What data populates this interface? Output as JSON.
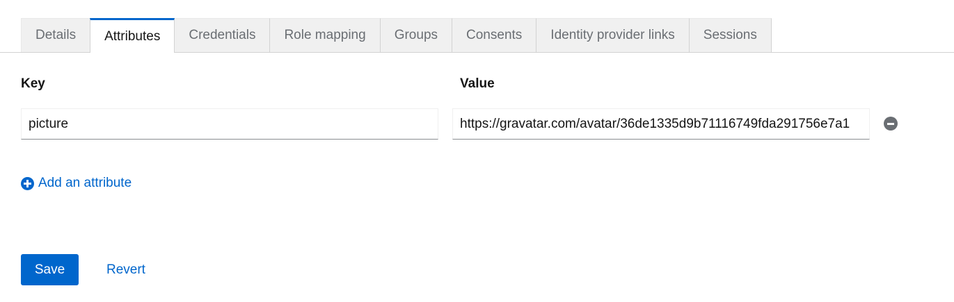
{
  "tabs": [
    {
      "label": "Details",
      "active": false
    },
    {
      "label": "Attributes",
      "active": true
    },
    {
      "label": "Credentials",
      "active": false
    },
    {
      "label": "Role mapping",
      "active": false
    },
    {
      "label": "Groups",
      "active": false
    },
    {
      "label": "Consents",
      "active": false
    },
    {
      "label": "Identity provider links",
      "active": false
    },
    {
      "label": "Sessions",
      "active": false
    }
  ],
  "attributes": {
    "key_label": "Key",
    "value_label": "Value",
    "rows": [
      {
        "key": "picture",
        "value": "https://gravatar.com/avatar/36de1335d9b71116749fda291756e7a1"
      }
    ],
    "add_label": "Add an attribute"
  },
  "actions": {
    "save_label": "Save",
    "revert_label": "Revert"
  },
  "colors": {
    "accent": "#0066cc",
    "tab_inactive_bg": "#f0f0f0",
    "remove_icon": "#6a6e73"
  },
  "icons": {
    "remove": "minus-circle-icon",
    "add": "plus-circle-icon"
  }
}
